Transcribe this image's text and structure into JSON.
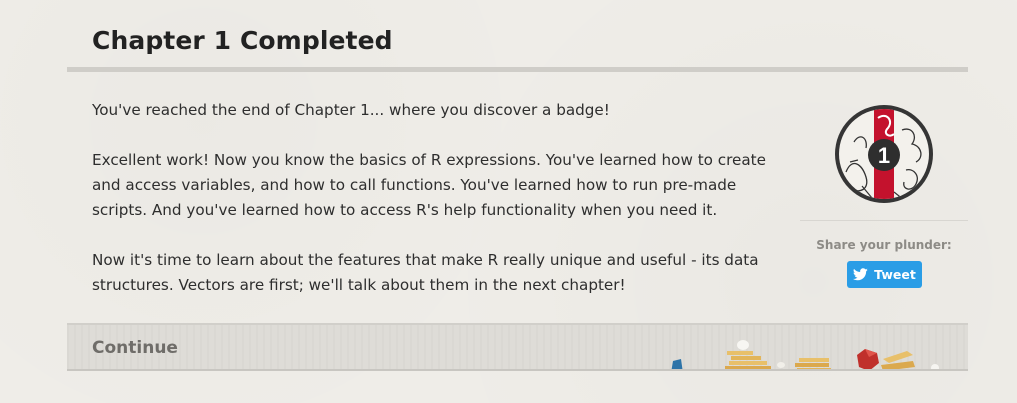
{
  "header": {
    "title": "Chapter 1 Completed"
  },
  "content": {
    "paragraphs": [
      "You've reached the end of Chapter 1... where you discover a badge!",
      "Excellent work! Now you know the basics of R expressions. You've learned how to create and access variables, and how to call functions. You've learned how to run pre-made scripts. And you've learned how to access R's help functionality when you need it.",
      "Now it's time to learn about the features that make R really unique and useful - its data structures. Vectors are first; we'll talk about them in the next chapter!"
    ]
  },
  "sidebar": {
    "badge_number": "1",
    "share_label": "Share your plunder:",
    "tweet_label": "Tweet"
  },
  "footer": {
    "continue_label": "Continue"
  },
  "colors": {
    "background": "#efede8",
    "accent_twitter": "#2a9de6",
    "badge_red": "#c4122d",
    "badge_ring": "#353535"
  },
  "icons": {
    "tweet": "twitter-bird-icon",
    "badge": "chapter-badge-icon"
  }
}
